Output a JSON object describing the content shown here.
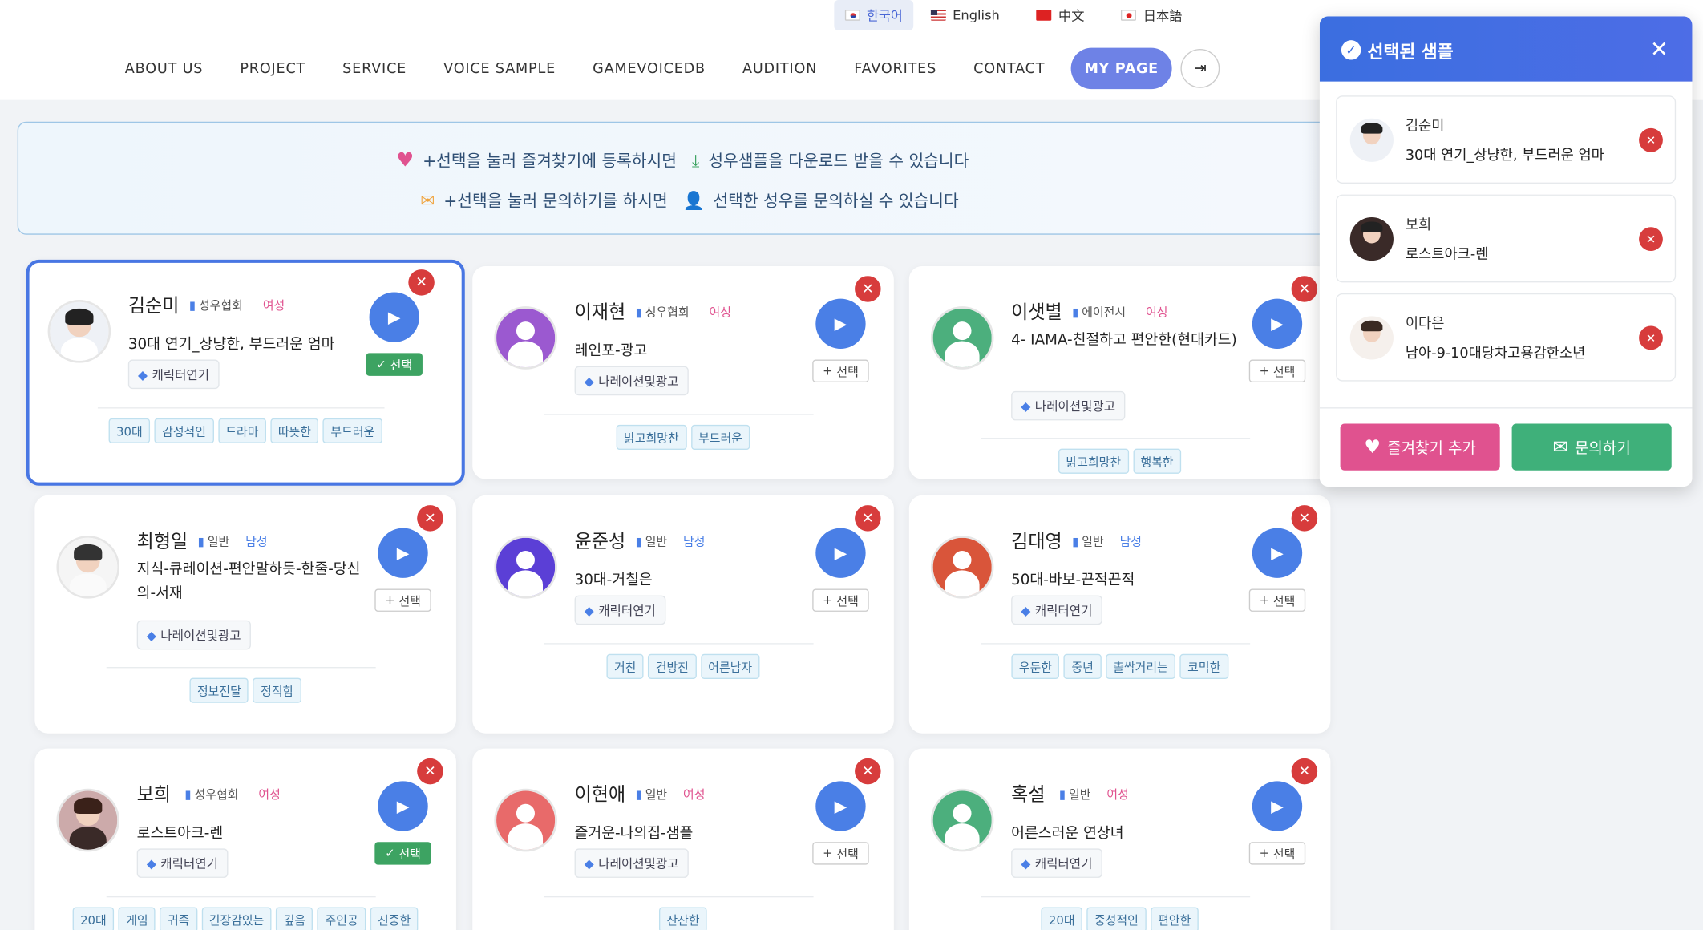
{
  "languages": [
    {
      "label": "한국어",
      "active": true
    },
    {
      "label": "English"
    },
    {
      "label": "中文"
    },
    {
      "label": "日本語"
    }
  ],
  "nav": [
    "ABOUT US",
    "PROJECT",
    "SERVICE",
    "VOICE SAMPLE",
    "GAMEVOICEDB",
    "AUDITION",
    "FAVORITES",
    "CONTACT"
  ],
  "mypage": "MY PAGE",
  "info": {
    "line1a": "+선택을 눌러 즐겨찾기에 등록하시면",
    "line1b": "성우샘플을 다운로드 받을 수 있습니다",
    "line2a": "+선택을 눌러 문의하기를 하시면",
    "line2b": "선택한 성우를 문의하실 수 있습니다"
  },
  "select_label": "선택",
  "colors": {
    "accent": "#4a7fe6",
    "selected": "#3da362",
    "remove": "#d73c3c",
    "heart": "#e0528f",
    "mail": "#f0a23a"
  },
  "cards": [
    {
      "name": "김순미",
      "assoc": "성우협회",
      "gender": "여성",
      "title": "30대 연기_상냥한, 부드러운 엄마",
      "category": "캐릭터연기",
      "tags": [
        "30대",
        "감성적인",
        "드라마",
        "따뜻한",
        "부드러운"
      ],
      "selected": true,
      "avatar": "photo"
    },
    {
      "name": "이재현",
      "assoc": "성우협회",
      "gender": "여성",
      "title": "레인포-광고",
      "category": "나레이션및광고",
      "tags": [
        "밝고희망찬",
        "부드러운"
      ],
      "selected": false,
      "avatar": "purple"
    },
    {
      "name": "이샛별",
      "assoc": "에이전시",
      "gender": "여성",
      "title": "4- IAMA-친절하고 편안한(현대카드)",
      "category": "나레이션및광고",
      "tags": [
        "밝고희망찬",
        "행복한"
      ],
      "selected": false,
      "avatar": "green"
    },
    {
      "name": "최형일",
      "assoc": "일반",
      "gender": "남성",
      "title": "지식-큐레이션-편안말하듯-한줄-당신의-서재",
      "category": "나레이션및광고",
      "tags": [
        "정보전달",
        "정직함"
      ],
      "selected": false,
      "avatar": "photo"
    },
    {
      "name": "윤준성",
      "assoc": "일반",
      "gender": "남성",
      "title": "30대-거칠은",
      "category": "캐릭터연기",
      "tags": [
        "거친",
        "건방진",
        "어른남자"
      ],
      "selected": false,
      "avatar": "indigo"
    },
    {
      "name": "김대영",
      "assoc": "일반",
      "gender": "남성",
      "title": "50대-바보-끈적끈적",
      "category": "캐릭터연기",
      "tags": [
        "우둔한",
        "중년",
        "촐싹거리는",
        "코믹한"
      ],
      "selected": false,
      "avatar": "red"
    },
    {
      "name": "보희",
      "assoc": "성우협회",
      "gender": "여성",
      "title": "로스트아크-렌",
      "category": "캐릭터연기",
      "tags": [
        "20대",
        "게임",
        "귀족",
        "긴장감있는",
        "깊음",
        "주인공",
        "진중한"
      ],
      "selected": true,
      "avatar": "photo"
    },
    {
      "name": "이현애",
      "assoc": "일반",
      "gender": "여성",
      "title": "즐거운-나의집-샘플",
      "category": "나레이션및광고",
      "tags": [
        "잔잔한"
      ],
      "selected": false,
      "avatar": "coral"
    },
    {
      "name": "혹설",
      "assoc": "일반",
      "gender": "여성",
      "title": "어른스러운 연상녀",
      "category": "캐릭터연기",
      "tags": [
        "20대",
        "중성적인",
        "편안한"
      ],
      "selected": false,
      "avatar": "green"
    }
  ],
  "panel": {
    "title": "선택된 샘플",
    "items": [
      {
        "name": "김순미",
        "title": "30대 연기_상냥한, 부드러운 엄마"
      },
      {
        "name": "보희",
        "title": "로스트아크-렌"
      },
      {
        "name": "이다은",
        "title": "남아-9-10대당차고용감한소년"
      }
    ],
    "fav_button": "즐겨찾기 추가",
    "inquiry_button": "문의하기"
  }
}
